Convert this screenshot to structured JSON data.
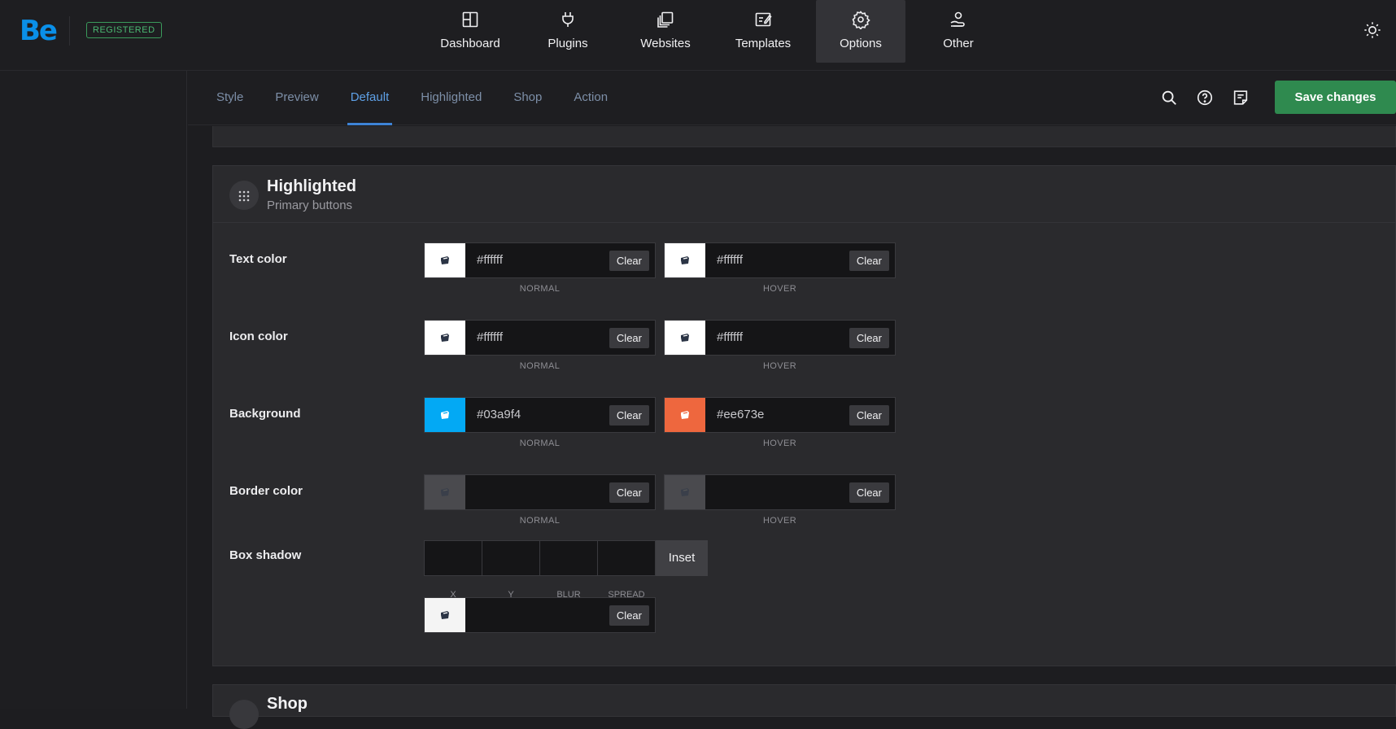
{
  "header": {
    "logo": "Be",
    "badge": "REGISTERED",
    "nav": [
      {
        "label": "Dashboard",
        "icon": "dashboard-icon"
      },
      {
        "label": "Plugins",
        "icon": "plug-icon"
      },
      {
        "label": "Websites",
        "icon": "websites-icon"
      },
      {
        "label": "Templates",
        "icon": "templates-icon"
      },
      {
        "label": "Options",
        "icon": "gear-icon",
        "active": true
      },
      {
        "label": "Other",
        "icon": "user-hand-icon"
      }
    ]
  },
  "tabs": [
    "Style",
    "Preview",
    "Default",
    "Highlighted",
    "Shop",
    "Action"
  ],
  "active_tab": "Default",
  "toolbar": {
    "save_label": "Save changes"
  },
  "panel": {
    "title": "Highlighted",
    "subtitle": "Primary buttons",
    "rows": [
      {
        "label": "Text color",
        "normal": {
          "value": "#ffffff",
          "swatch": "#ffffff"
        },
        "hover": {
          "value": "#ffffff",
          "swatch": "#ffffff"
        }
      },
      {
        "label": "Icon color",
        "normal": {
          "value": "#ffffff",
          "swatch": "#ffffff"
        },
        "hover": {
          "value": "#ffffff",
          "swatch": "#ffffff"
        }
      },
      {
        "label": "Background",
        "normal": {
          "value": "#03a9f4",
          "swatch": "#03a9f4"
        },
        "hover": {
          "value": "#ee673e",
          "swatch": "#ee673e"
        }
      },
      {
        "label": "Border color",
        "normal": {
          "value": "",
          "swatch": "#4a4a4e"
        },
        "hover": {
          "value": "",
          "swatch": "#4a4a4e"
        }
      }
    ],
    "normal_label": "NORMAL",
    "hover_label": "HOVER",
    "clear_label": "Clear",
    "box_shadow": {
      "label": "Box shadow",
      "fields": [
        "X",
        "Y",
        "BLUR",
        "SPREAD"
      ],
      "inset_label": "Inset",
      "color": {
        "value": "",
        "swatch": "#f4f4f4"
      }
    }
  },
  "next_panel": {
    "title": "Shop"
  }
}
